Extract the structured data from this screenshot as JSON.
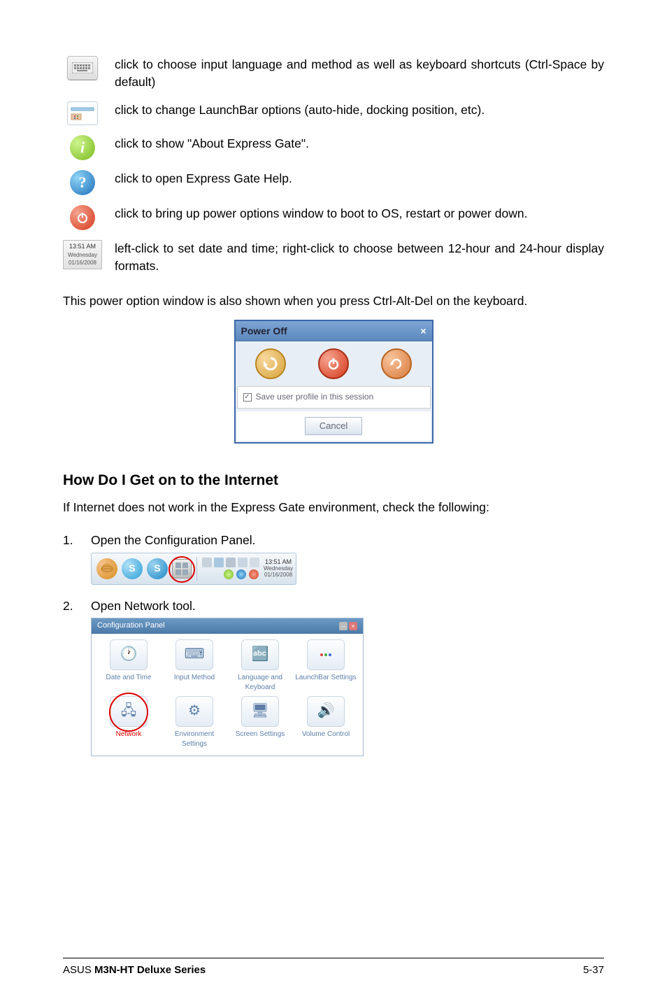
{
  "icons": [
    {
      "name": "keyboard",
      "desc": "click to choose input language and method as well as keyboard shortcuts (Ctrl-Space by default)"
    },
    {
      "name": "launchbar",
      "desc": "click to change LaunchBar options (auto-hide, docking position, etc)."
    },
    {
      "name": "info",
      "desc": "click to show \"About Express Gate\"."
    },
    {
      "name": "help",
      "desc": "click to open Express Gate Help."
    },
    {
      "name": "power",
      "desc": "click to bring up power options window to boot to OS, restart or power down."
    },
    {
      "name": "clock",
      "desc": "left-click to set date and time; right-click to choose between 12-hour and 24-hour display formats."
    }
  ],
  "clock_widget": {
    "time": "13:51 AM",
    "day": "Wednesday",
    "date": "01/16/2008"
  },
  "power_para": "This power option window is also shown when you press Ctrl-Alt-Del on the keyboard.",
  "power_dialog": {
    "title": "Power Off",
    "checkbox_label": "Save user profile in this session",
    "cancel": "Cancel"
  },
  "heading": "How Do I Get on to the Internet",
  "heading_sub": "If Internet does not work in the Express Gate environment, check the following:",
  "steps": [
    {
      "num": "1.",
      "text": "Open the Configuration Panel."
    },
    {
      "num": "2.",
      "text": "Open Network tool."
    }
  ],
  "launchbar_clock": {
    "time": "13:51 AM",
    "day": "Wednesday",
    "date": "01/16/2008"
  },
  "config_panel": {
    "title": "Configuration Panel",
    "items": [
      {
        "label": "Date and Time",
        "glyph": "🕐"
      },
      {
        "label": "Input Method",
        "glyph": "⌨"
      },
      {
        "label": "Language and Keyboard",
        "glyph": "🔤"
      },
      {
        "label": "LaunchBar Settings",
        "glyph": "▭"
      },
      {
        "label": "Network",
        "glyph": "🖧",
        "highlight": true
      },
      {
        "label": "Environment Settings",
        "glyph": "⚙"
      },
      {
        "label": "Screen Settings",
        "glyph": "🖥"
      },
      {
        "label": "Volume Control",
        "glyph": "🔊"
      }
    ]
  },
  "footer": {
    "left_prefix": "ASUS ",
    "left_bold": "M3N-HT Deluxe Series",
    "right": "5-37"
  }
}
